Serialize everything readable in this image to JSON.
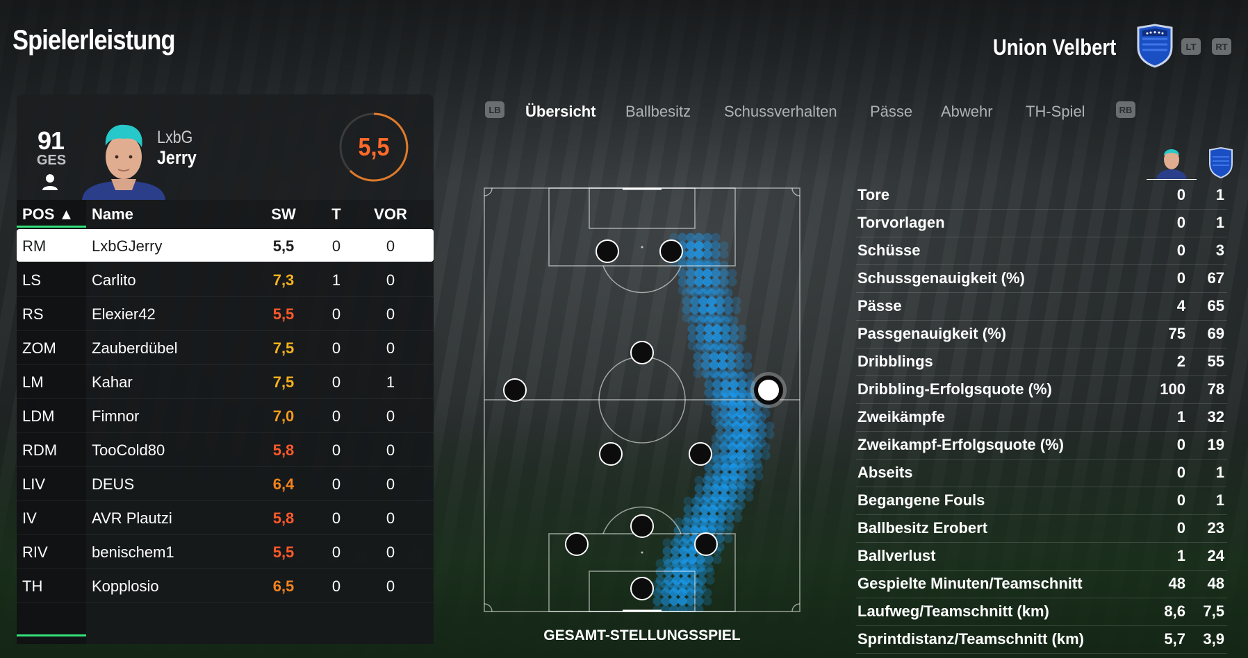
{
  "header": {
    "title": "Spielerleistung",
    "team_name": "Union Velbert",
    "btn_lt": "LT",
    "btn_rt": "RT"
  },
  "player_card": {
    "overall": "91",
    "overall_label": "GES",
    "prefix": "LxbG",
    "name": "Jerry",
    "rating": "5,5"
  },
  "table": {
    "headers": {
      "pos": "POS ▲",
      "name": "Name",
      "sw": "SW",
      "t": "T",
      "vor": "VOR"
    },
    "rows": [
      {
        "pos": "RM",
        "name": "LxbGJerry",
        "sw": "5,5",
        "t": "0",
        "vor": "0",
        "color": "#1b1c1d"
      },
      {
        "pos": "LS",
        "name": "Carlito",
        "sw": "7,3",
        "t": "1",
        "vor": "0",
        "color": "#f5b21d"
      },
      {
        "pos": "RS",
        "name": "Elexier42",
        "sw": "5,5",
        "t": "0",
        "vor": "0",
        "color": "#ff5a2a"
      },
      {
        "pos": "ZOM",
        "name": "Zauberdübel",
        "sw": "7,5",
        "t": "0",
        "vor": "0",
        "color": "#f5b21d"
      },
      {
        "pos": "LM",
        "name": "Kahar",
        "sw": "7,5",
        "t": "0",
        "vor": "1",
        "color": "#f5b21d"
      },
      {
        "pos": "LDM",
        "name": "Fimnor",
        "sw": "7,0",
        "t": "0",
        "vor": "0",
        "color": "#f59a1d"
      },
      {
        "pos": "RDM",
        "name": "TooCold80",
        "sw": "5,8",
        "t": "0",
        "vor": "0",
        "color": "#ff5a2a"
      },
      {
        "pos": "LIV",
        "name": "DEUS",
        "sw": "6,4",
        "t": "0",
        "vor": "0",
        "color": "#f5841d"
      },
      {
        "pos": "IV",
        "name": "AVR Plautzi",
        "sw": "5,8",
        "t": "0",
        "vor": "0",
        "color": "#ff5a2a"
      },
      {
        "pos": "RIV",
        "name": "benischem1",
        "sw": "5,5",
        "t": "0",
        "vor": "0",
        "color": "#ff5a2a"
      },
      {
        "pos": "TH",
        "name": "Kopplosio",
        "sw": "6,5",
        "t": "0",
        "vor": "0",
        "color": "#f5841d"
      }
    ]
  },
  "tabs": {
    "lb": "LB",
    "rb": "RB",
    "items": [
      "Übersicht",
      "Ballbesitz",
      "Schussverhalten",
      "Pässe",
      "Abwehr",
      "TH-Spiel"
    ],
    "active": "Übersicht"
  },
  "pitch": {
    "caption": "GESAMT-STELLUNGSSPIEL",
    "heatmap_color": "#1aa3ff"
  },
  "stats": [
    {
      "label": "Tore",
      "player": "0",
      "team": "1"
    },
    {
      "label": "Torvorlagen",
      "player": "0",
      "team": "1"
    },
    {
      "label": "Schüsse",
      "player": "0",
      "team": "3"
    },
    {
      "label": "Schussgenauigkeit (%)",
      "player": "0",
      "team": "67"
    },
    {
      "label": "Pässe",
      "player": "4",
      "team": "65"
    },
    {
      "label": "Passgenauigkeit (%)",
      "player": "75",
      "team": "69"
    },
    {
      "label": "Dribblings",
      "player": "2",
      "team": "55"
    },
    {
      "label": "Dribbling-Erfolgsquote (%)",
      "player": "100",
      "team": "78"
    },
    {
      "label": "Zweikämpfe",
      "player": "1",
      "team": "32"
    },
    {
      "label": "Zweikampf-Erfolgsquote (%)",
      "player": "0",
      "team": "19"
    },
    {
      "label": "Abseits",
      "player": "0",
      "team": "1"
    },
    {
      "label": "Begangene Fouls",
      "player": "0",
      "team": "1"
    },
    {
      "label": "Ballbesitz Erobert",
      "player": "0",
      "team": "23"
    },
    {
      "label": "Ballverlust",
      "player": "1",
      "team": "24"
    },
    {
      "label": "Gespielte Minuten/Teamschnitt",
      "player": "48",
      "team": "48"
    },
    {
      "label": "Laufweg/Teamschnitt (km)",
      "player": "8,6",
      "team": "7,5"
    },
    {
      "label": "Sprintdistanz/Teamschnitt (km)",
      "player": "5,7",
      "team": "3,9"
    }
  ]
}
